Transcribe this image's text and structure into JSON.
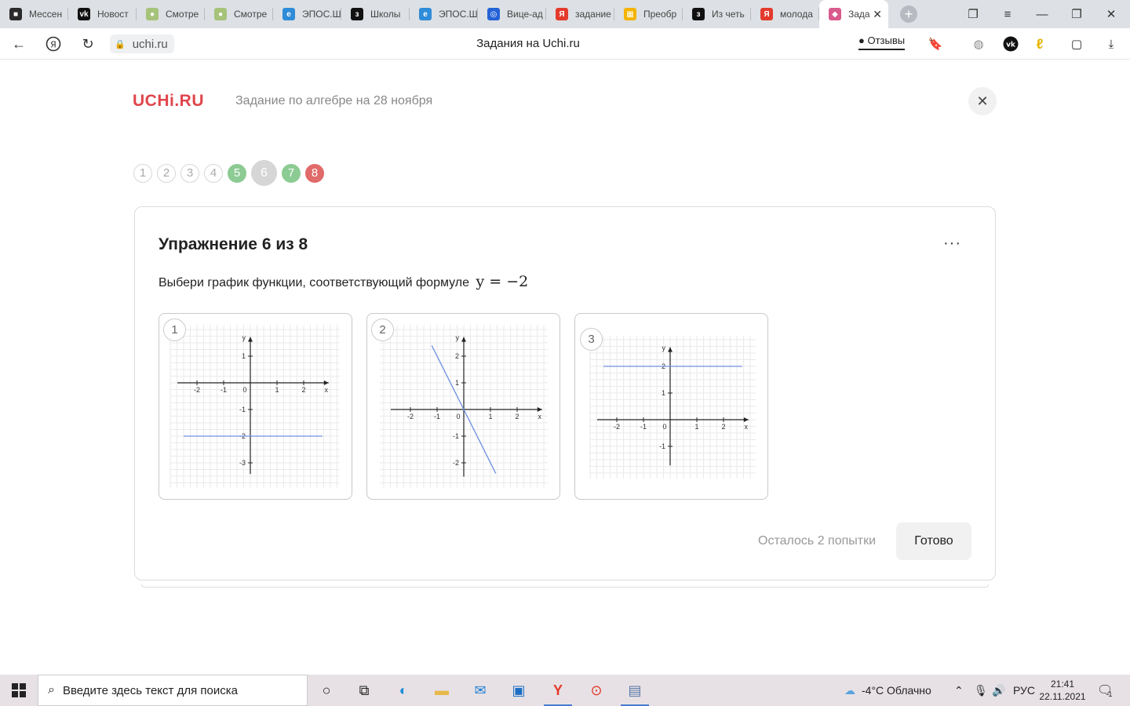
{
  "tabs": [
    {
      "label": "Мессен",
      "icon": "chat-icon",
      "color": "#2b2b2b",
      "glyph": "■"
    },
    {
      "label": "Новост",
      "icon": "vk-icon",
      "color": "#111111",
      "glyph": "vk"
    },
    {
      "label": "Смотре",
      "icon": "video-icon",
      "color": "#a6c37a",
      "glyph": "●"
    },
    {
      "label": "Смотре",
      "icon": "video-icon",
      "color": "#a6c37a",
      "glyph": "●"
    },
    {
      "label": "ЭПОС.Ш",
      "icon": "edge-icon",
      "color": "#2f8cd8",
      "glyph": "e"
    },
    {
      "label": "Школы",
      "icon": "zen-icon",
      "color": "#111111",
      "glyph": "з"
    },
    {
      "label": "ЭПОС.Ш",
      "icon": "edge-icon",
      "color": "#2f8cd8",
      "glyph": "e"
    },
    {
      "label": "Вице-ад",
      "icon": "browser-icon",
      "color": "#2462d6",
      "glyph": "◎"
    },
    {
      "label": "задание",
      "icon": "yandex-icon",
      "color": "#e33a2c",
      "glyph": "Я"
    },
    {
      "label": "Преобр",
      "icon": "windows-icon",
      "color": "#f4b400",
      "glyph": "▦"
    },
    {
      "label": "Из четь",
      "icon": "zen-icon",
      "color": "#111111",
      "glyph": "з"
    },
    {
      "label": "молода",
      "icon": "yandex-icon",
      "color": "#e33a2c",
      "glyph": "Я"
    },
    {
      "label": "Зада",
      "icon": "uchi-icon",
      "color": "#d95a8c",
      "glyph": "◆",
      "active": true
    }
  ],
  "browser": {
    "url": "uchi.ru",
    "page_heading": "Задания на Uchi.ru",
    "reviews_label": "Отзывы"
  },
  "page": {
    "logo": "UCHi.RU",
    "task_title": "Задание по алгебре на 28 ноября",
    "brand_color": "#e0454c",
    "steps": [
      {
        "num": "1",
        "state": "open"
      },
      {
        "num": "2",
        "state": "open"
      },
      {
        "num": "3",
        "state": "open"
      },
      {
        "num": "4",
        "state": "open"
      },
      {
        "num": "5",
        "state": "correct"
      },
      {
        "num": "6",
        "state": "current"
      },
      {
        "num": "7",
        "state": "correct"
      },
      {
        "num": "8",
        "state": "wrong"
      }
    ],
    "exercise_title": "Упражнение 6 из 8",
    "more_label": "···",
    "question_text": "Выбери график функции, соответствующий формуле",
    "question_formula": "y = −2",
    "attempts_text": "Осталось 2 попытки",
    "done_label": "Готово"
  },
  "graphs": [
    {
      "num": "1",
      "x_ticks": [
        "-2",
        "-1",
        "0",
        "1",
        "2",
        "x"
      ],
      "y_ticks": [
        "y",
        "1",
        "-1",
        "-2",
        "-3"
      ],
      "line": {
        "x1": -2.5,
        "y1": -2,
        "x2": 2.7,
        "y2": -2
      },
      "xlim": [
        -2.5,
        2.7
      ],
      "ylim": [
        -3.3,
        1.6
      ]
    },
    {
      "num": "2",
      "x_ticks": [
        "-2",
        "-1",
        "0",
        "1",
        "2",
        "x"
      ],
      "y_ticks": [
        "y",
        "2",
        "1",
        "-1",
        "-2"
      ],
      "line": {
        "x1": -1.2,
        "y1": 2.4,
        "x2": 1.2,
        "y2": -2.4
      },
      "xlim": [
        -2.5,
        2.7
      ],
      "ylim": [
        -2.4,
        2.6
      ]
    },
    {
      "num": "3",
      "x_ticks": [
        "-2",
        "-1",
        "0",
        "1",
        "2",
        "x"
      ],
      "y_ticks": [
        "y",
        "2",
        "1",
        "-1"
      ],
      "line": {
        "x1": -2.5,
        "y1": 2,
        "x2": 2.7,
        "y2": 2
      },
      "xlim": [
        -2.5,
        2.7
      ],
      "ylim": [
        -1.6,
        2.6
      ]
    }
  ],
  "line_color": "#6f8fe0",
  "taskbar": {
    "search_placeholder": "Введите здесь текст для поиска",
    "weather": "-4°C  Облачно",
    "lang": "РУС",
    "time": "21:41",
    "date": "22.11.2021",
    "notifications": "1"
  }
}
